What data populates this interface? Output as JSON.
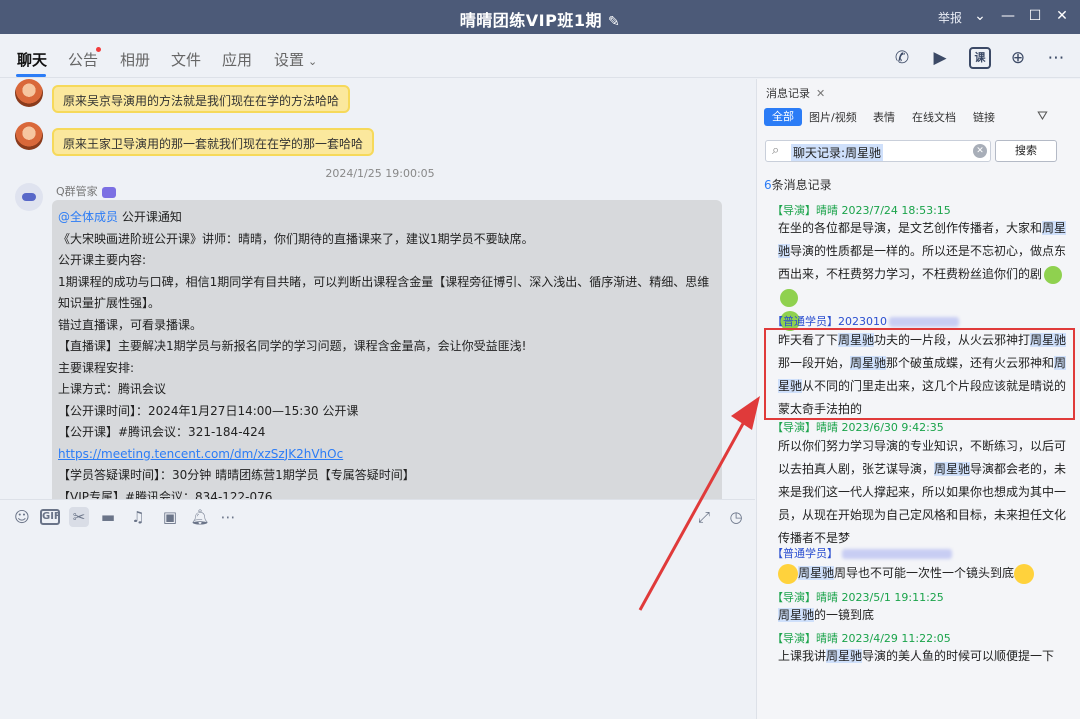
{
  "window": {
    "title": "晴晴团练VIP班1期",
    "report_label": "举报"
  },
  "tabs": [
    {
      "label": "聊天"
    },
    {
      "label": "公告"
    },
    {
      "label": "相册"
    },
    {
      "label": "文件"
    },
    {
      "label": "应用"
    },
    {
      "label": "设置"
    }
  ],
  "toolbar_icons": {
    "lesson_label": "课"
  },
  "chat": {
    "messages_top": [
      {
        "text": "原来吴京导演用的方法就是我们现在在学的方法哈哈"
      },
      {
        "text": "原来王家卫导演用的那一套就我们现在在学的那一套哈哈"
      }
    ],
    "timestamp": "2024/1/25 19:00:05",
    "sender": "Q群管家",
    "notice": {
      "mention": "@全体成员",
      "title": " 公开课通知",
      "lines": [
        "《大宋映画进阶班公开课》讲师：晴晴，你们期待的直播课来了，建议1期学员不要缺席。",
        "公开课主要内容:",
        "1期课程的成功与口碑，相信1期同学有目共睹，可以判断出课程含金量【课程旁征博引、深入浅出、循序渐进、精细、思维知识量扩展性强】。",
        "错过直播课，可看录播课。",
        "【直播课】主要解决1期学员与新报名同学的学习问题，课程含金量高，会让你受益匪浅!",
        "主要课程安排:",
        "上课方式：腾讯会议",
        "【公开课时间】：2024年1月27日14:00—15:30 公开课",
        "【公开课】#腾讯会议：321-184-424"
      ],
      "link": "https://meeting.tencent.com/dm/xzSzJK2hVhOc",
      "lines_after": [
        "【学员答疑课时间】：30分钟 晴晴团练营1期学员【专属答疑时间】",
        "【VIP专属】#腾讯会议：834-122-076"
      ]
    }
  },
  "history": {
    "tab_label": "消息记录",
    "filters": [
      "全部",
      "图片/视频",
      "表情",
      "在线文档",
      "链接"
    ],
    "search": {
      "value": "聊天记录:周星驰",
      "button": "搜索"
    },
    "count": {
      "num": "6",
      "text": "条消息记录"
    },
    "records": [
      {
        "head": "【导演】晴晴 2023/7/24 18:53:15",
        "segments": [
          [
            "在坐的各位都是导演，是文艺创作传播者，大家和",
            false
          ],
          [
            "周星驰",
            true
          ],
          [
            "导演的性质都是一样的。所以还是不忘初心，做点东西出来，不枉费努力学习，不枉费粉丝追你们的剧",
            false
          ]
        ]
      },
      {
        "head": "【普通学员】2023010",
        "segments": [
          [
            "昨天看了下",
            false
          ],
          [
            "周星驰",
            true
          ],
          [
            "功夫的一片段，从火云邪神打",
            false
          ],
          [
            "周星驰",
            true
          ],
          [
            "那一段开始，",
            false
          ],
          [
            "周星驰",
            true
          ],
          [
            "那个破茧成蝶，还有火云邪神和",
            false
          ],
          [
            "周星驰",
            true
          ],
          [
            "从不同的门里走出来，这几个片段应该就是晴说的蒙太奇手法拍的",
            false
          ]
        ]
      },
      {
        "head": "【导演】晴晴 2023/6/30 9:42:35",
        "segments": [
          [
            "所以你们努力学习导演的专业知识，不断练习，以后可以去拍真人剧，张艺谋导演，",
            false
          ],
          [
            "周星驰",
            true
          ],
          [
            "导演都会老的，未来是我们这一代人撑起来，所以如果你也想成为其中一员，从现在开始现为自己定风格和目标，未来担任文化传播者不是梦",
            false
          ]
        ]
      },
      {
        "head": "【普通学员】",
        "segments": [
          [
            "周星驰",
            true
          ],
          [
            "周导也不可能一次性一个镜头到底",
            false
          ]
        ]
      },
      {
        "head": "【导演】晴晴 2023/5/1 19:11:25",
        "segments": [
          [
            "周星驰",
            true
          ],
          [
            "的一镜到底",
            false
          ]
        ]
      },
      {
        "head": "【导演】晴晴 2023/4/29 11:22:05",
        "segments": [
          [
            "上课我讲",
            false
          ],
          [
            "周星驰",
            true
          ],
          [
            "导演的美人鱼的时候可以顺便提一下",
            false
          ]
        ]
      }
    ]
  },
  "colors": {
    "titlebar": "#4c5a78",
    "accent": "#2b7cf6",
    "director_head": "#1aa34a",
    "student_head": "#2b4fd0",
    "highlight_box": "#e03a3a"
  }
}
